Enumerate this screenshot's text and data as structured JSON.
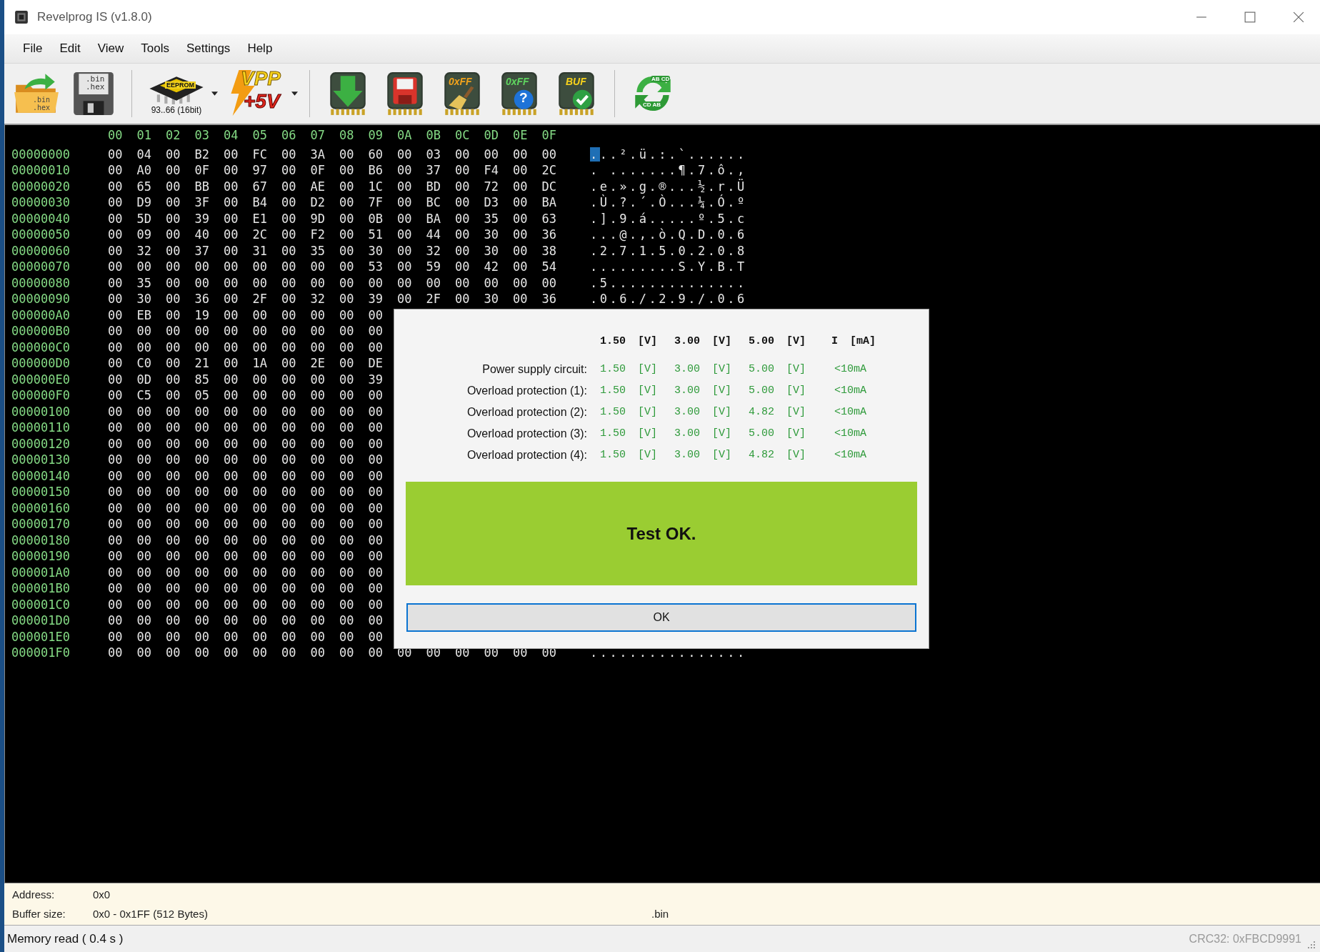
{
  "window": {
    "title": "Revelprog IS (v1.8.0)"
  },
  "menu": [
    "File",
    "Edit",
    "View",
    "Tools",
    "Settings",
    "Help"
  ],
  "toolbar": [
    {
      "kind": "open",
      "lines": [
        ".bin",
        ".hex"
      ],
      "dropdown": false
    },
    {
      "kind": "save",
      "lines": [
        ".bin",
        ".hex"
      ],
      "dropdown": false
    },
    {
      "kind": "separator"
    },
    {
      "kind": "chip",
      "lines": [
        "EEPROM"
      ],
      "caption": "93..66 (16bit)",
      "dropdown": true
    },
    {
      "kind": "vpp",
      "lines": [
        "VPP",
        "+5V"
      ],
      "dropdown": true
    },
    {
      "kind": "separator"
    },
    {
      "kind": "read",
      "dropdown": false
    },
    {
      "kind": "write",
      "dropdown": false
    },
    {
      "kind": "erase",
      "lines": [
        "0xFF"
      ],
      "dropdown": false
    },
    {
      "kind": "blank",
      "lines": [
        "0xFF",
        "?"
      ],
      "dropdown": false
    },
    {
      "kind": "verify",
      "lines": [
        "BUF"
      ],
      "dropdown": false
    },
    {
      "kind": "separator"
    },
    {
      "kind": "swap",
      "lines": [
        "AB CD",
        "CD AB"
      ],
      "dropdown": false
    }
  ],
  "hex_view": {
    "columns": [
      "00",
      "01",
      "02",
      "03",
      "04",
      "05",
      "06",
      "07",
      "08",
      "09",
      "0A",
      "0B",
      "0C",
      "0D",
      "0E",
      "0F"
    ],
    "rows": [
      {
        "address": "00000000",
        "bytes": [
          "00",
          "04",
          "00",
          "B2",
          "00",
          "FC",
          "00",
          "3A",
          "00",
          "60",
          "00",
          "03",
          "00",
          "00",
          "00",
          "00"
        ],
        "ascii": "...².ü.:.`......",
        "cursor": true
      },
      {
        "address": "00000010",
        "bytes": [
          "00",
          "A0",
          "00",
          "0F",
          "00",
          "97",
          "00",
          "0F",
          "00",
          "B6",
          "00",
          "37",
          "00",
          "F4",
          "00",
          "2C"
        ],
        "ascii": ". .......¶.7.ô.,",
        "cursor": false
      },
      {
        "address": "00000020",
        "bytes": [
          "00",
          "65",
          "00",
          "BB",
          "00",
          "67",
          "00",
          "AE",
          "00",
          "1C",
          "00",
          "BD",
          "00",
          "72",
          "00",
          "DC"
        ],
        "ascii": ".e.».g.®...½.r.Ü",
        "cursor": false
      },
      {
        "address": "00000030",
        "bytes": [
          "00",
          "D9",
          "00",
          "3F",
          "00",
          "B4",
          "00",
          "D2",
          "00",
          "7F",
          "00",
          "BC",
          "00",
          "D3",
          "00",
          "BA"
        ],
        "ascii": ".Ù.?.´.Ò...¼.Ó.º",
        "cursor": false
      },
      {
        "address": "00000040",
        "bytes": [
          "00",
          "5D",
          "00",
          "39",
          "00",
          "E1",
          "00",
          "9D",
          "00",
          "0B",
          "00",
          "BA",
          "00",
          "35",
          "00",
          "63"
        ],
        "ascii": ".].9.á.....º.5.c",
        "cursor": false
      },
      {
        "address": "00000050",
        "bytes": [
          "00",
          "09",
          "00",
          "40",
          "00",
          "2C",
          "00",
          "F2",
          "00",
          "51",
          "00",
          "44",
          "00",
          "30",
          "00",
          "36"
        ],
        "ascii": "...@.,.ò.Q.D.0.6",
        "cursor": false
      },
      {
        "address": "00000060",
        "bytes": [
          "00",
          "32",
          "00",
          "37",
          "00",
          "31",
          "00",
          "35",
          "00",
          "30",
          "00",
          "32",
          "00",
          "30",
          "00",
          "38"
        ],
        "ascii": ".2.7.1.5.0.2.0.8",
        "cursor": false
      },
      {
        "address": "00000070",
        "bytes": [
          "00",
          "00",
          "00",
          "00",
          "00",
          "00",
          "00",
          "00",
          "00",
          "53",
          "00",
          "59",
          "00",
          "42",
          "00",
          "54"
        ],
        "ascii": ".........S.Y.B.T",
        "cursor": false
      },
      {
        "address": "00000080",
        "bytes": [
          "00",
          "35",
          "00",
          "00",
          "00",
          "00",
          "00",
          "00",
          "00",
          "00",
          "00",
          "00",
          "00",
          "00",
          "00",
          "00"
        ],
        "ascii": ".5..............",
        "cursor": false
      },
      {
        "address": "00000090",
        "bytes": [
          "00",
          "30",
          "00",
          "36",
          "00",
          "2F",
          "00",
          "32",
          "00",
          "39",
          "00",
          "2F",
          "00",
          "30",
          "00",
          "36"
        ],
        "ascii": ".0.6./.2.9./.0.6",
        "cursor": false
      },
      {
        "address": "000000A0",
        "bytes": [
          "00",
          "EB",
          "00",
          "19",
          "00",
          "00",
          "00",
          "00",
          "00",
          "00"
        ],
        "cursor": false
      },
      {
        "address": "000000B0",
        "bytes": [
          "00",
          "00",
          "00",
          "00",
          "00",
          "00",
          "00",
          "00",
          "00",
          "00"
        ],
        "cursor": false
      },
      {
        "address": "000000C0",
        "bytes": [
          "00",
          "00",
          "00",
          "00",
          "00",
          "00",
          "00",
          "00",
          "00",
          "00"
        ],
        "cursor": false
      },
      {
        "address": "000000D0",
        "bytes": [
          "00",
          "C0",
          "00",
          "21",
          "00",
          "1A",
          "00",
          "2E",
          "00",
          "DE"
        ],
        "cursor": false
      },
      {
        "address": "000000E0",
        "bytes": [
          "00",
          "0D",
          "00",
          "85",
          "00",
          "00",
          "00",
          "00",
          "00",
          "39"
        ],
        "cursor": false
      },
      {
        "address": "000000F0",
        "bytes": [
          "00",
          "C5",
          "00",
          "05",
          "00",
          "00",
          "00",
          "00",
          "00",
          "00"
        ],
        "cursor": false
      },
      {
        "address": "00000100",
        "bytes": [
          "00",
          "00",
          "00",
          "00",
          "00",
          "00",
          "00",
          "00",
          "00",
          "00"
        ],
        "cursor": false
      },
      {
        "address": "00000110",
        "bytes": [
          "00",
          "00",
          "00",
          "00",
          "00",
          "00",
          "00",
          "00",
          "00",
          "00"
        ],
        "cursor": false
      },
      {
        "address": "00000120",
        "bytes": [
          "00",
          "00",
          "00",
          "00",
          "00",
          "00",
          "00",
          "00",
          "00",
          "00"
        ],
        "cursor": false
      },
      {
        "address": "00000130",
        "bytes": [
          "00",
          "00",
          "00",
          "00",
          "00",
          "00",
          "00",
          "00",
          "00",
          "00"
        ],
        "cursor": false
      },
      {
        "address": "00000140",
        "bytes": [
          "00",
          "00",
          "00",
          "00",
          "00",
          "00",
          "00",
          "00",
          "00",
          "00"
        ],
        "cursor": false
      },
      {
        "address": "00000150",
        "bytes": [
          "00",
          "00",
          "00",
          "00",
          "00",
          "00",
          "00",
          "00",
          "00",
          "00"
        ],
        "cursor": false
      },
      {
        "address": "00000160",
        "bytes": [
          "00",
          "00",
          "00",
          "00",
          "00",
          "00",
          "00",
          "00",
          "00",
          "00"
        ],
        "cursor": false
      },
      {
        "address": "00000170",
        "bytes": [
          "00",
          "00",
          "00",
          "00",
          "00",
          "00",
          "00",
          "00",
          "00",
          "00"
        ],
        "cursor": false
      },
      {
        "address": "00000180",
        "bytes": [
          "00",
          "00",
          "00",
          "00",
          "00",
          "00",
          "00",
          "00",
          "00",
          "00"
        ],
        "cursor": false
      },
      {
        "address": "00000190",
        "bytes": [
          "00",
          "00",
          "00",
          "00",
          "00",
          "00",
          "00",
          "00",
          "00",
          "00"
        ],
        "cursor": false
      },
      {
        "address": "000001A0",
        "bytes": [
          "00",
          "00",
          "00",
          "00",
          "00",
          "00",
          "00",
          "00",
          "00",
          "00"
        ],
        "cursor": false
      },
      {
        "address": "000001B0",
        "bytes": [
          "00",
          "00",
          "00",
          "00",
          "00",
          "00",
          "00",
          "00",
          "00",
          "00"
        ],
        "cursor": false
      },
      {
        "address": "000001C0",
        "bytes": [
          "00",
          "00",
          "00",
          "00",
          "00",
          "00",
          "00",
          "00",
          "00",
          "00"
        ],
        "cursor": false
      },
      {
        "address": "000001D0",
        "bytes": [
          "00",
          "00",
          "00",
          "00",
          "00",
          "00",
          "00",
          "00",
          "00",
          "00"
        ],
        "cursor": false
      },
      {
        "address": "000001E0",
        "bytes": [
          "00",
          "00",
          "00",
          "00",
          "00",
          "00",
          "00",
          "00",
          "00",
          "00"
        ],
        "cursor": false
      },
      {
        "address": "000001F0",
        "bytes": [
          "00",
          "00",
          "00",
          "00",
          "00",
          "00",
          "00",
          "00",
          "00",
          "00",
          "00",
          "00",
          "00",
          "00",
          "00",
          "00"
        ],
        "ascii": "................",
        "cursor": false
      }
    ]
  },
  "dialog": {
    "header": [
      "1.50 [V]",
      "3.00 [V]",
      "5.00 [V]",
      "I [mA]"
    ],
    "rows": [
      {
        "label": "Power supply circuit:",
        "values": [
          "1.50 [V]",
          "3.00 [V]",
          "5.00 [V]",
          "<10mA"
        ]
      },
      {
        "label": "Overload protection (1):",
        "values": [
          "1.50 [V]",
          "3.00 [V]",
          "5.00 [V]",
          "<10mA"
        ]
      },
      {
        "label": "Overload protection (2):",
        "values": [
          "1.50 [V]",
          "3.00 [V]",
          "4.82 [V]",
          "<10mA"
        ]
      },
      {
        "label": "Overload protection (3):",
        "values": [
          "1.50 [V]",
          "3.00 [V]",
          "5.00 [V]",
          "<10mA"
        ]
      },
      {
        "label": "Overload protection (4):",
        "values": [
          "1.50 [V]",
          "3.00 [V]",
          "4.82 [V]",
          "<10mA"
        ]
      }
    ],
    "result": "Test OK.",
    "button": "OK"
  },
  "info_panel": {
    "address_label": "Address:",
    "address": "0x0",
    "buffer_label": "Buffer size:",
    "buffer": "0x0 - 0x1FF (512 Bytes)",
    "file_extension": ".bin"
  },
  "status_bar": {
    "message": "Memory read ( 0.4 s )",
    "crc": "CRC32: 0xFBCD9991"
  }
}
